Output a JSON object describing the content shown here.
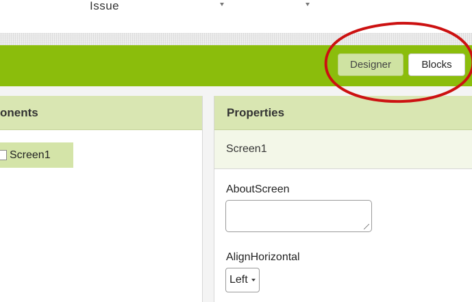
{
  "topbar": {
    "menu_label": "Issue"
  },
  "toolbar": {
    "designer_label": "Designer",
    "blocks_label": "Blocks",
    "highlight_color": "#cc1111",
    "accent_color": "#8bbd0c"
  },
  "components_panel": {
    "header": "onents",
    "tree": [
      {
        "label": "Screen1"
      }
    ]
  },
  "properties_panel": {
    "header": "Properties",
    "component_name": "Screen1",
    "properties": [
      {
        "label": "AboutScreen",
        "value": ""
      },
      {
        "label": "AlignHorizontal",
        "value": "Left"
      }
    ]
  }
}
